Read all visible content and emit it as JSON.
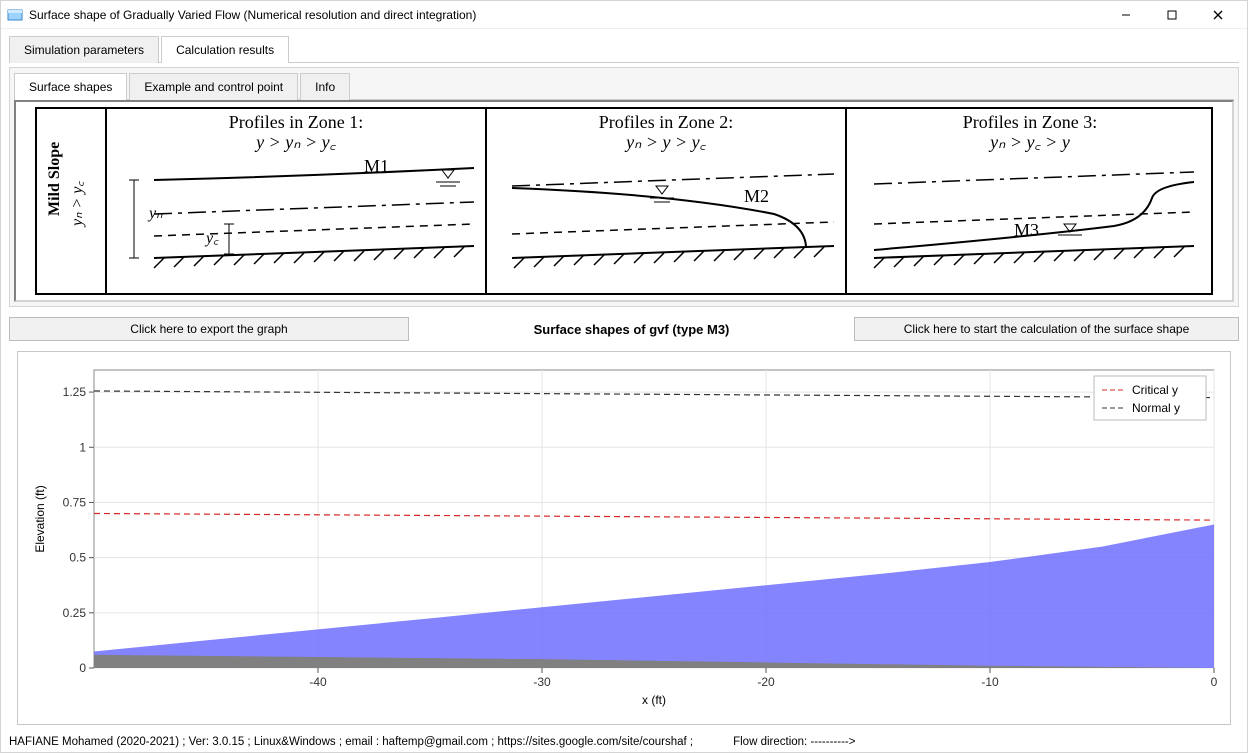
{
  "window": {
    "title": "Surface shape of Gradually Varied Flow (Numerical resolution and direct integration)"
  },
  "outer_tabs": {
    "sim_params": "Simulation parameters",
    "calc_results": "Calculation results",
    "active": "calc_results"
  },
  "inner_tabs": {
    "surface_shapes": "Surface shapes",
    "example_cp": "Example and control point",
    "info": "Info",
    "active": "surface_shapes"
  },
  "diagram": {
    "left_label": "Mild Slope",
    "left_cond": "yₙ > y꜀",
    "z1_title": "Profiles in Zone 1:",
    "z1_cond": "y > yₙ > y꜀",
    "z2_title": "Profiles in Zone 2:",
    "z2_cond": "yₙ > y > y꜀",
    "z3_title": "Profiles in Zone 3:",
    "z3_cond": "yₙ > y꜀ > y",
    "yn_lbl": "yₙ",
    "yc_lbl": "y꜀",
    "m1": "M1",
    "m2": "M2",
    "m3": "M3"
  },
  "buttons": {
    "export": "Click here to export the graph",
    "start": "Click here to start the calculation of the surface shape"
  },
  "mid_label": "Surface shapes of gvf (type M3)",
  "chart": {
    "ylabel": "Elevation (ft)",
    "xlabel": "x (ft)",
    "legend_critical": "Critical y",
    "legend_normal": "Normal y"
  },
  "chart_data": {
    "type": "area+line",
    "xlabel": "x (ft)",
    "ylabel": "Elevation (ft)",
    "xlim": [
      -50,
      0
    ],
    "ylim": [
      0,
      1.35
    ],
    "xticks": [
      -40,
      -30,
      -20,
      -10,
      0
    ],
    "yticks": [
      0,
      0.25,
      0.5,
      0.75,
      1,
      1.25
    ],
    "series": [
      {
        "name": "Bed",
        "type": "area",
        "color": "#808080",
        "x": [
          -50,
          -40,
          -30,
          -20,
          -10,
          0
        ],
        "values": [
          0.06,
          0.05,
          0.04,
          0.025,
          0.01,
          0.0
        ]
      },
      {
        "name": "Water surface (M3)",
        "type": "area",
        "color": "#6f6fff",
        "x": [
          -50,
          -45,
          -40,
          -35,
          -30,
          -25,
          -20,
          -15,
          -10,
          -5,
          0
        ],
        "values": [
          0.075,
          0.125,
          0.175,
          0.225,
          0.275,
          0.325,
          0.375,
          0.425,
          0.48,
          0.55,
          0.65
        ]
      },
      {
        "name": "Critical y",
        "type": "line",
        "style": "dashed",
        "color": "#d62728",
        "x": [
          -50,
          0
        ],
        "values": [
          0.7,
          0.67
        ]
      },
      {
        "name": "Normal y",
        "type": "line",
        "style": "dashed",
        "color": "#333333",
        "x": [
          -50,
          0
        ],
        "values": [
          1.255,
          1.225
        ]
      }
    ],
    "legend": [
      "Critical y",
      "Normal y"
    ]
  },
  "footer": {
    "credits": "HAFIANE Mohamed (2020-2021) ; Ver: 3.0.15 ; Linux&Windows ; email : haftemp@gmail.com ; https://sites.google.com/site/courshaf     ;",
    "flowdir": "Flow direction: ---------->"
  }
}
